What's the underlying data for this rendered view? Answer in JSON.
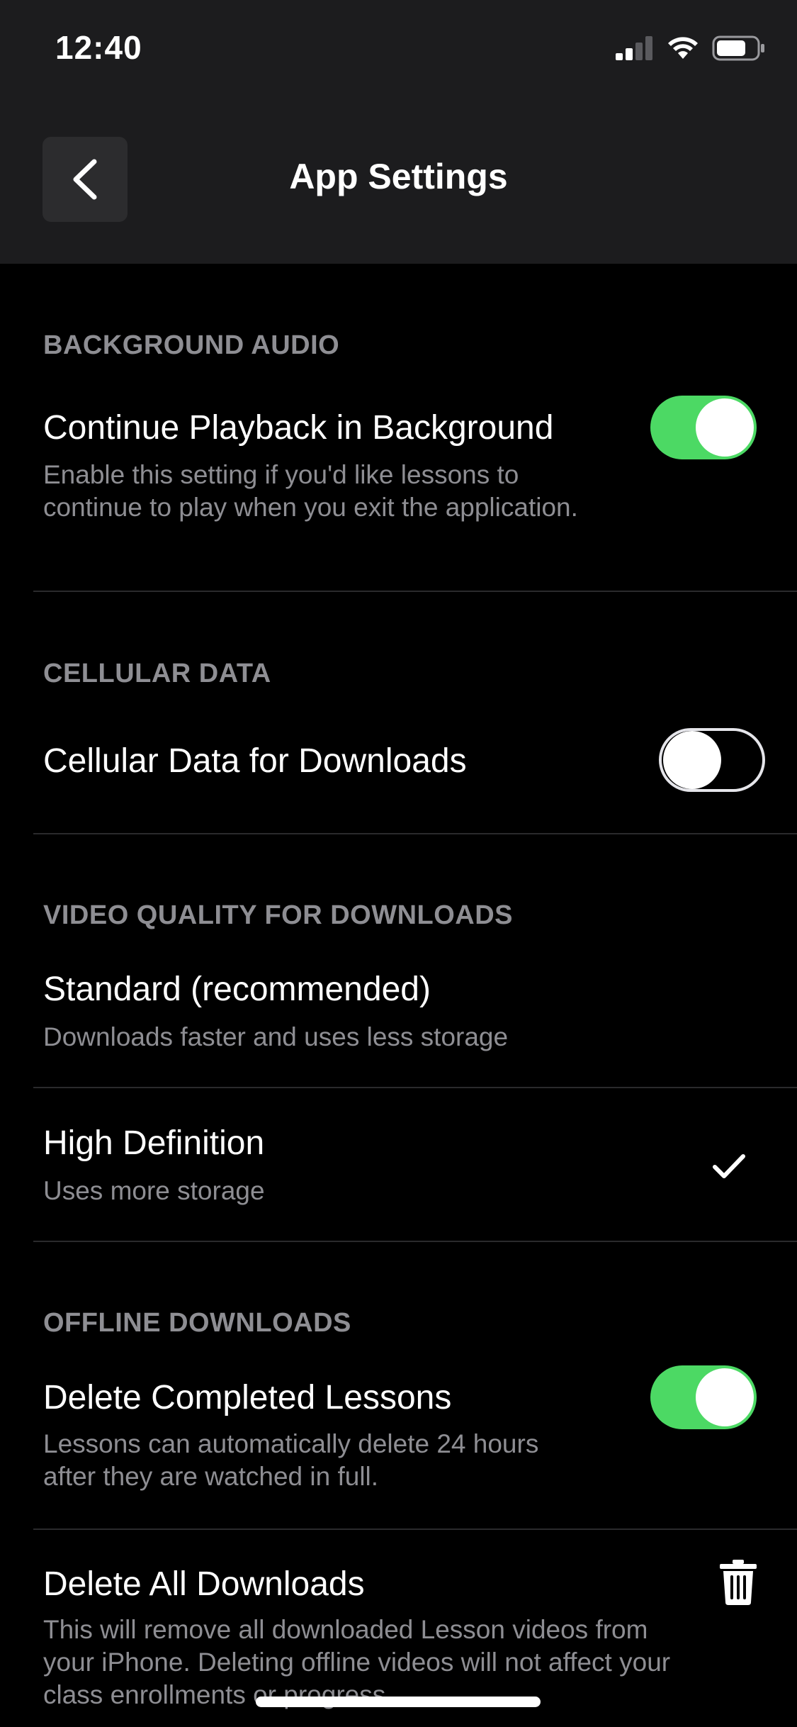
{
  "status_bar": {
    "time": "12:40"
  },
  "nav": {
    "title": "App Settings",
    "back_icon": "chevron-left-icon"
  },
  "sections": {
    "background_audio": {
      "header": "BACKGROUND AUDIO",
      "row": {
        "title": "Continue Playback in Background",
        "description": "Enable this setting if you'd like lessons to continue to play when you exit the application.",
        "toggle_on": true
      }
    },
    "cellular_data": {
      "header": "CELLULAR DATA",
      "row": {
        "title": "Cellular Data for Downloads",
        "toggle_on": false
      }
    },
    "video_quality": {
      "header": "VIDEO QUALITY FOR DOWNLOADS",
      "options": [
        {
          "title": "Standard (recommended)",
          "description": "Downloads faster and uses less storage",
          "selected": false
        },
        {
          "title": "High Definition",
          "description": "Uses more storage",
          "selected": true
        }
      ]
    },
    "offline_downloads": {
      "header": "OFFLINE DOWNLOADS",
      "delete_completed": {
        "title": "Delete Completed Lessons",
        "description": "Lessons can automatically delete 24 hours after they are watched in full.",
        "toggle_on": true
      },
      "delete_all": {
        "title": "Delete All Downloads",
        "description": "This will remove all downloaded Lesson videos from your iPhone. Deleting offline videos will not affect your class enrollments or progress."
      }
    }
  },
  "colors": {
    "toggle_on": "#4cd964",
    "header_text": "#8e8e93",
    "nav_background": "#1c1c1e",
    "background": "#000000"
  }
}
